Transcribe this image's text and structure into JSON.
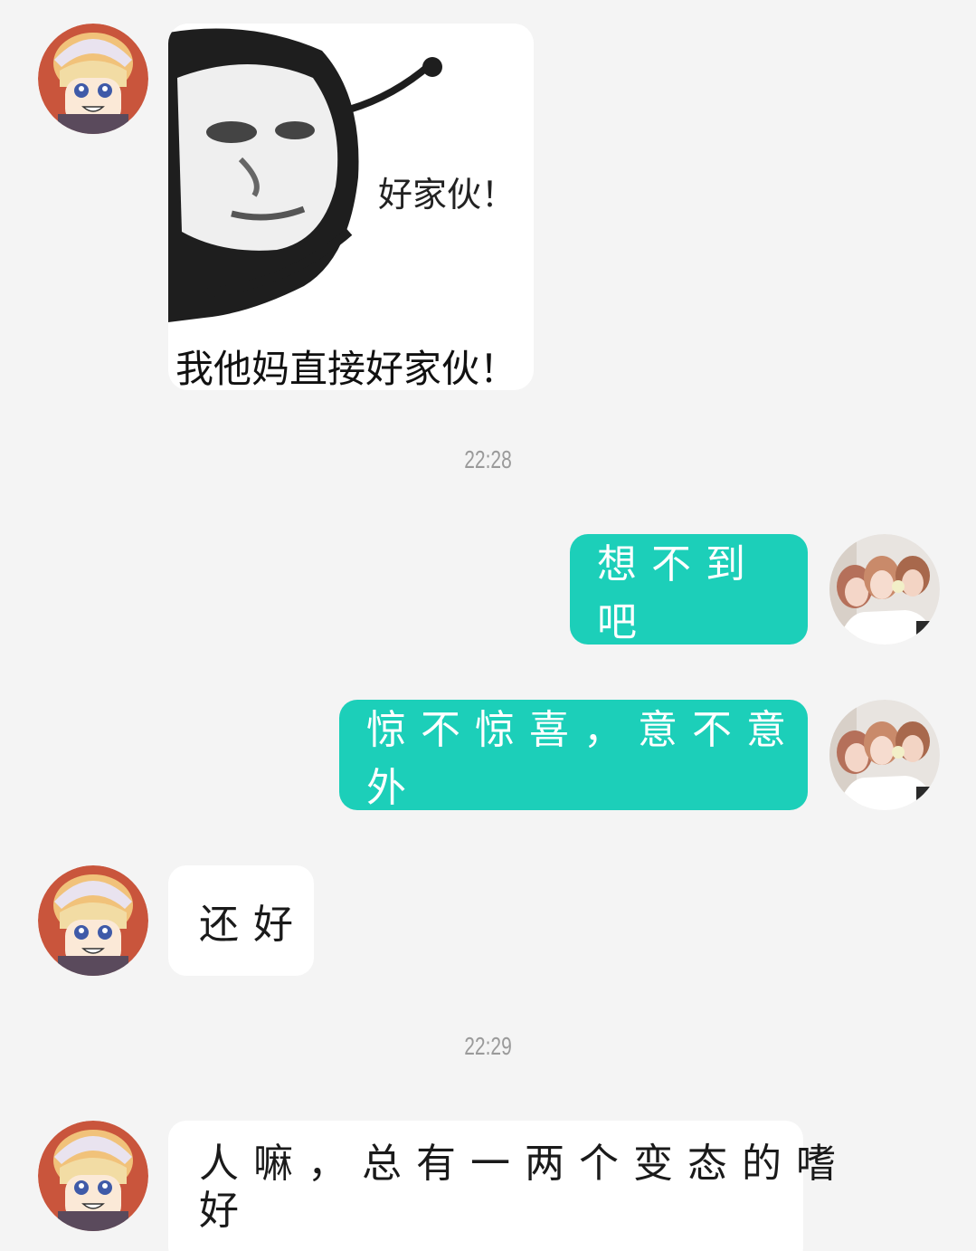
{
  "messages": [
    {
      "sender": "other",
      "type": "sticker",
      "sticker_text": "好家伙！",
      "sticker_caption": "我他妈直接好家伙！"
    },
    {
      "type": "timestamp",
      "text": "22:28"
    },
    {
      "sender": "me",
      "type": "text",
      "text": "想不到吧"
    },
    {
      "sender": "me",
      "type": "text",
      "text": "惊不惊喜，意不意外"
    },
    {
      "sender": "other",
      "type": "text",
      "text": "还好"
    },
    {
      "type": "timestamp",
      "text": "22:29"
    },
    {
      "sender": "other",
      "type": "text",
      "line1": "人嘛，总有一两个变态的嗜",
      "line2": "好"
    }
  ],
  "colors": {
    "background": "#f4f4f4",
    "outgoing_bubble": "#1ccfb9",
    "incoming_bubble": "#ffffff",
    "timestamp": "#9a9a9a"
  },
  "icons": {
    "other_avatar": "anime-character-avatar",
    "my_avatar": "group-photo-avatar"
  }
}
